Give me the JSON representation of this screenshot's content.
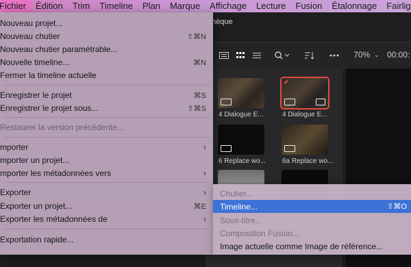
{
  "menubar": {
    "items": [
      "Fichier",
      "Édition",
      "Trim",
      "Timeline",
      "Plan",
      "Marque",
      "Affichage",
      "Lecture",
      "Fusion",
      "Étalonnage",
      "Fairlight"
    ]
  },
  "app": {
    "tab_title": "othèque",
    "zoom": "70%",
    "timecode": "00:00:",
    "clips": [
      {
        "label": "4 Dialogue E...",
        "selected": false
      },
      {
        "label": "4 Dialogue E...",
        "selected": true
      },
      {
        "label": "6 Replace wo...",
        "selected": false
      },
      {
        "label": "6a Replace wo...",
        "selected": false
      }
    ]
  },
  "menu": {
    "items": [
      {
        "label": "Nouveau projet...",
        "shortcut": ""
      },
      {
        "label": "Nouveau chutier",
        "shortcut": "⇧⌘N"
      },
      {
        "label": "Nouveau chutier paramétrable...",
        "shortcut": ""
      },
      {
        "label": "Nouvelle timeline...",
        "shortcut": "⌘N"
      },
      {
        "label": "Fermer la timeline actuelle",
        "shortcut": ""
      },
      {
        "label": "Enregistrer le projet",
        "shortcut": "⌘S"
      },
      {
        "label": "Enregistrer le projet sous...",
        "shortcut": "⇧⌘S"
      },
      {
        "label": "Restaurer la version précédente...",
        "shortcut": ""
      },
      {
        "label": "mporter",
        "shortcut": ""
      },
      {
        "label": "mporter un projet...",
        "shortcut": ""
      },
      {
        "label": "mporter les métadonnées vers",
        "shortcut": ""
      },
      {
        "label": "Exporter",
        "shortcut": ""
      },
      {
        "label": "Exporter un projet...",
        "shortcut": "⌘E"
      },
      {
        "label": "Exporter les métadonnées de",
        "shortcut": ""
      },
      {
        "label": "Exportation rapide...",
        "shortcut": ""
      }
    ]
  },
  "submenu": {
    "items": [
      {
        "label": "Chutier...",
        "shortcut": ""
      },
      {
        "label": "Timeline...",
        "shortcut": "⇧⌘O"
      },
      {
        "label": "Sous-titre...",
        "shortcut": ""
      },
      {
        "label": "Composition Fusion...",
        "shortcut": ""
      },
      {
        "label": "Image actuelle comme Image de référence...",
        "shortcut": ""
      }
    ]
  }
}
